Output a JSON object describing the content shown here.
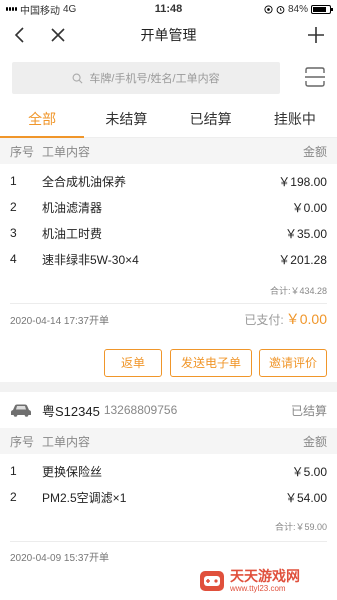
{
  "status_bar": {
    "carrier": "中国移动",
    "network": "4G",
    "time": "11:48",
    "battery": "84%",
    "battery_level": 0.84
  },
  "nav": {
    "title": "开单管理"
  },
  "search": {
    "placeholder": "车牌/手机号/姓名/工单内容"
  },
  "tabs": [
    {
      "label": "全部",
      "active": true
    },
    {
      "label": "未结算",
      "active": false
    },
    {
      "label": "已结算",
      "active": false
    },
    {
      "label": "挂账中",
      "active": false
    }
  ],
  "table_headers": {
    "no": "序号",
    "content": "工单内容",
    "amount": "金额"
  },
  "orders": [
    {
      "items": [
        {
          "no": "1",
          "content": "全合成机油保养",
          "amount": "￥198.00"
        },
        {
          "no": "2",
          "content": "机油滤清器",
          "amount": "￥0.00"
        },
        {
          "no": "3",
          "content": "机油工时费",
          "amount": "￥35.00"
        },
        {
          "no": "4",
          "content": "速非绿非5W-30×4",
          "amount": "￥201.28"
        }
      ],
      "subtotal": "合计:￥434.28",
      "date": "2020-04-14 17:37开单",
      "paid_label": "已支付:",
      "paid_value": "￥0.00",
      "buttons": [
        "返单",
        "发送电子单",
        "邀请评价"
      ]
    },
    {
      "plate": "粤S12345",
      "phone": "13268809756",
      "status": "已结算",
      "items": [
        {
          "no": "1",
          "content": "更换保险丝",
          "amount": "￥5.00"
        },
        {
          "no": "2",
          "content": "PM2.5空调滤×1",
          "amount": "￥54.00"
        }
      ],
      "subtotal": "合计:￥59.00",
      "date": "2020-04-09 15:37开单"
    }
  ],
  "watermark": {
    "title": "天天游戏网",
    "url": "www.ttyl23.com"
  },
  "colors": {
    "accent": "#f0962a",
    "background": "#f2f2f2"
  }
}
